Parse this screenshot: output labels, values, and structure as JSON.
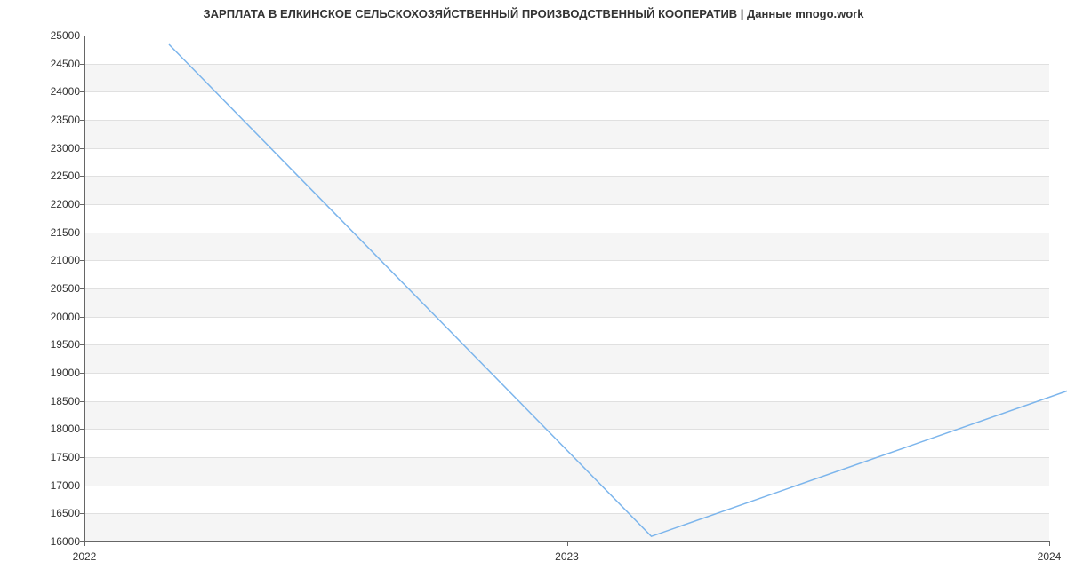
{
  "chart_data": {
    "type": "line",
    "title": "ЗАРПЛАТА В ЕЛКИНСКОЕ СЕЛЬСКОХОЗЯЙСТВЕННЫЙ ПРОИЗВОДСТВЕННЫЙ КООПЕРАТИВ | Данные mnogo.work",
    "x": [
      2022,
      2023,
      2024
    ],
    "values": [
      25000,
      16250,
      19250
    ],
    "xlabel": "",
    "ylabel": "",
    "ylim": [
      16000,
      25000
    ],
    "x_ticks": [
      "2022",
      "2023",
      "2024"
    ],
    "y_ticks": [
      16000,
      16500,
      17000,
      17500,
      18000,
      18500,
      19000,
      19500,
      20000,
      20500,
      21000,
      21500,
      22000,
      22500,
      23000,
      23500,
      24000,
      24500,
      25000
    ],
    "line_color": "#7cb5ec"
  }
}
